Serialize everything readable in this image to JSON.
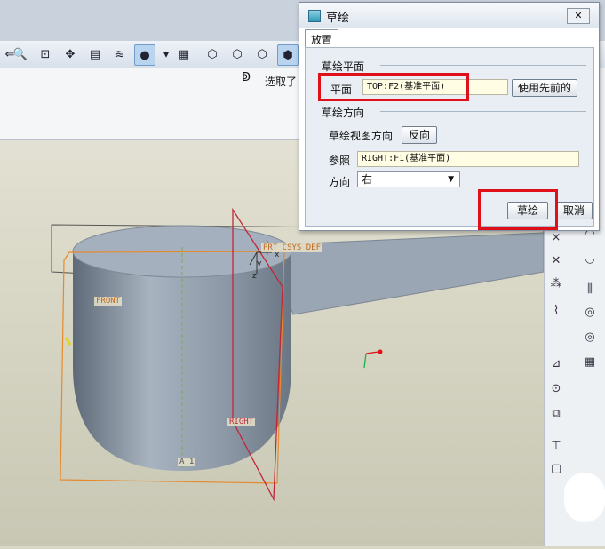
{
  "toolbar": {
    "buttons": [
      "zoom-in-icon",
      "zoom-box-icon",
      "datum-display-icon",
      "annotation-icon",
      "layers-icon",
      "spin-center-icon",
      "save-view-icon",
      "view-3d-icon",
      "view-box-icon",
      "view-box2-icon",
      "view-box3-icon",
      "view-box4-icon"
    ],
    "select_label": "选取了"
  },
  "viewport": {
    "labels": {
      "csys": "PRT_CSYS_DEF",
      "front": "FRONT",
      "right": "RIGHT",
      "axis": "A_1",
      "z": "z",
      "y": "y",
      "x": "x"
    }
  },
  "dialog": {
    "title": "草绘",
    "close": "✕",
    "tab": "放置",
    "section_plane": "草绘平面",
    "plane_label": "平面",
    "plane_value": "TOP:F2(基准平面)",
    "use_previous": "使用先前的",
    "section_direction": "草绘方向",
    "view_direction_label": "草绘视图方向",
    "flip": "反向",
    "reference_label": "参照",
    "reference_value": "RIGHT:F1(基准平面)",
    "orientation_label": "方向",
    "orientation_value": "右",
    "sketch_button": "草绘",
    "cancel_button": "取消"
  },
  "colors": {
    "highlight": "#e0101a",
    "datum_orange": "#e68a2e",
    "datum_red": "#c0273a",
    "model_fill": "#8d99a7"
  }
}
